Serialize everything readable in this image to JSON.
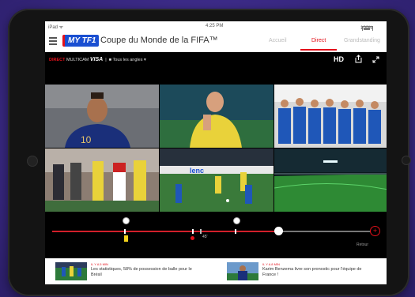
{
  "status_bar": {
    "carrier": "iPad ᯤ",
    "time": "4:25 PM",
    "battery": "100%"
  },
  "nav": {
    "logo": "MY TF1",
    "title": "Coupe du Monde de la FIFA™",
    "tabs": [
      {
        "label": "Accueil",
        "active": false
      },
      {
        "label": "Direct",
        "active": true
      },
      {
        "label": "Grandstanding",
        "active": false
      }
    ]
  },
  "sub_bar": {
    "direct": "DIRECT",
    "multicam": "MULTICAM",
    "sponsor": "VISA",
    "angles": "Tous les angles ▾",
    "quality": "HD"
  },
  "timeline": {
    "progress": 0.71,
    "minute_label": "45'",
    "back_label": "Retour"
  },
  "news": [
    {
      "meta": "IL Y A 5 MIN",
      "headline": "Les statistiques, 58% de possession de balle pour le Brésil"
    },
    {
      "meta": "IL Y A 8 MIN",
      "headline": "Karim Benzema livre son pronostic pour l'équipe de France !"
    }
  ],
  "colors": {
    "accent": "#e3101a",
    "logo_blue": "#1a4fd1",
    "background": "#3b2a86"
  }
}
